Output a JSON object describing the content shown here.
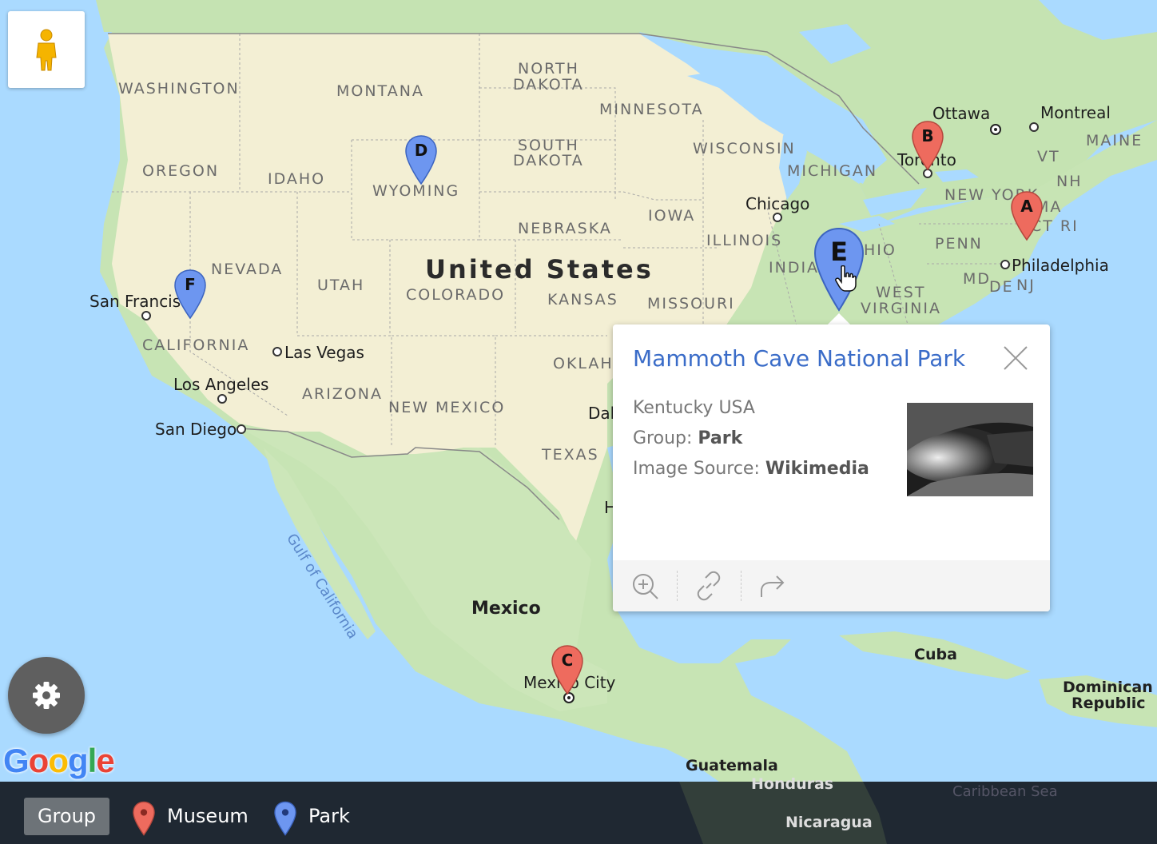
{
  "map": {
    "country_labels": {
      "usa": "United States",
      "mexico": "Mexico",
      "cuba": "Cuba",
      "dominican_1": "Dominican",
      "dominican_2": "Republic",
      "guatemala": "Guatemala",
      "honduras": "Honduras",
      "nicaragua": "Nicaragua"
    },
    "water_labels": {
      "gulf_california": "Gulf of California",
      "caribbean": "Caribbean Sea"
    },
    "state_labels": {
      "washington": "WASHINGTON",
      "oregon": "OREGON",
      "idaho": "IDAHO",
      "montana": "MONTANA",
      "wyoming": "WYOMING",
      "nevada": "NEVADA",
      "utah": "UTAH",
      "colorado": "COLORADO",
      "california": "CALIFORNIA",
      "arizona": "ARIZONA",
      "new_mexico": "NEW MEXICO",
      "texas": "TEXAS",
      "north_dakota_1": "NORTH",
      "north_dakota_2": "DAKOTA",
      "south_dakota_1": "SOUTH",
      "south_dakota_2": "DAKOTA",
      "nebraska": "NEBRASKA",
      "kansas": "KANSAS",
      "oklahoma": "OKLAH",
      "minnesota": "MINNESOTA",
      "wisconsin": "WISCONSIN",
      "iowa": "IOWA",
      "illinois": "ILLINOIS",
      "missouri": "MISSOURI",
      "michigan": "MICHIGAN",
      "indiana": "INDIA",
      "ohio": "HIO",
      "west_virginia_1": "WEST",
      "west_virginia_2": "VIRGINIA",
      "penn": "PENN",
      "new_york": "NEW YORK",
      "md": "MD",
      "de": "DE",
      "nj": "NJ",
      "vt": "VT",
      "nh": "NH",
      "maine": "MAINE",
      "ma": "MA",
      "ct_ri": "CT RI"
    },
    "city_labels": {
      "ottawa": "Ottawa",
      "montreal": "Montreal",
      "toronto": "Toronto",
      "chicago": "Chicago",
      "philadelphia": "Philadelphia",
      "san_francisco": "San Francisco",
      "las_vegas": "Las Vegas",
      "los_angeles": "Los Angeles",
      "san_diego": "San Diego",
      "dallas": "Dal",
      "houston": "H",
      "mexico_city": "Mexico City"
    },
    "markers": {
      "a": {
        "letter": "A",
        "group": "Museum"
      },
      "b": {
        "letter": "B",
        "group": "Museum"
      },
      "c": {
        "letter": "C",
        "group": "Museum"
      },
      "d": {
        "letter": "D",
        "group": "Park"
      },
      "e": {
        "letter": "E",
        "group": "Park",
        "selected": true
      },
      "f": {
        "letter": "F",
        "group": "Park"
      }
    },
    "colors": {
      "museum": "#ee6b5e",
      "park": "#6d96f0",
      "land": "#c7e4b4",
      "usa_land": "#f4f0d6",
      "water": "#aadaff",
      "title": "#3a6cc8"
    }
  },
  "controls": {
    "pegman_icon": "pegman-icon",
    "settings_icon": "gear-icon",
    "google_logo": {
      "g1": "G",
      "o1": "o",
      "o2": "o",
      "g2": "g",
      "l": "l",
      "e": "e"
    }
  },
  "popup": {
    "title": "Mammoth Cave National Park",
    "location": "Kentucky USA",
    "group_label": "Group:",
    "group_value": "Park",
    "source_label": "Image Source:",
    "source_value": "Wikimedia",
    "actions": [
      "zoom-in-icon",
      "link-icon",
      "share-icon"
    ]
  },
  "legend": {
    "group_button": "Group",
    "items": [
      {
        "label": "Museum",
        "icon": "museum-marker-icon"
      },
      {
        "label": "Park",
        "icon": "park-marker-icon"
      }
    ]
  }
}
